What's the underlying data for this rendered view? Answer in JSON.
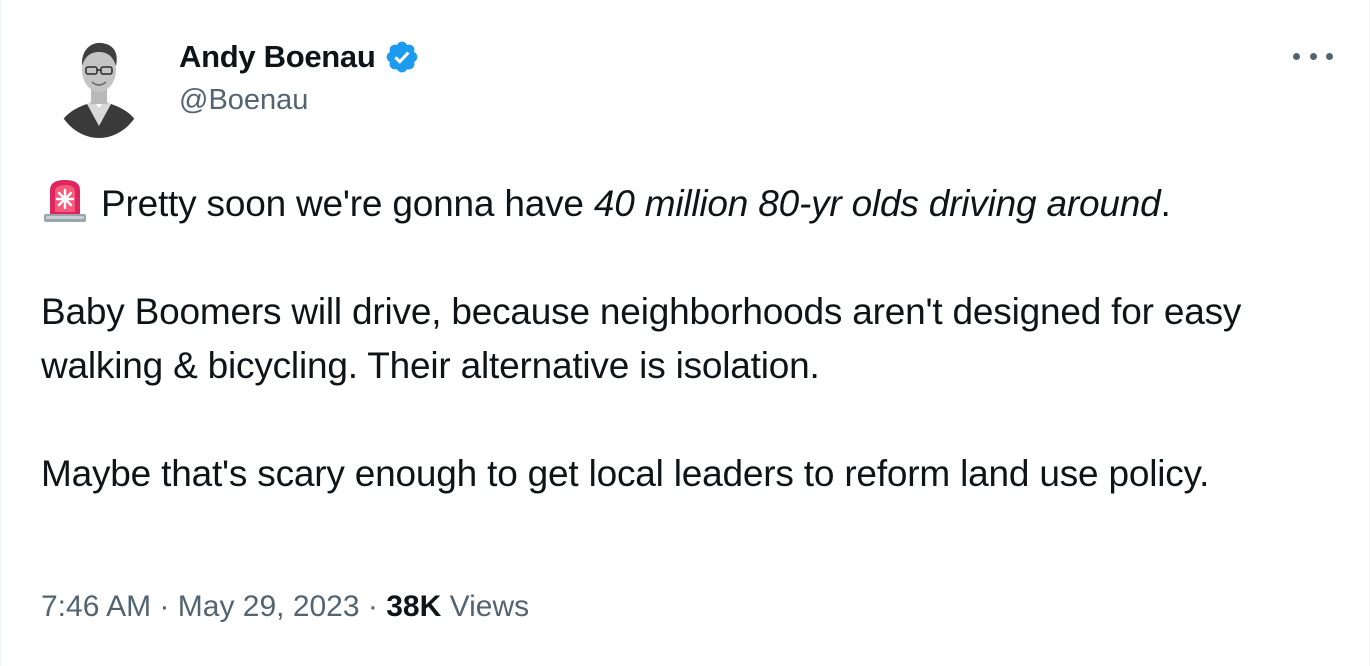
{
  "author": {
    "display_name": "Andy Boenau",
    "handle": "@Boenau",
    "verified_icon": "verified-badge-icon",
    "avatar": "author-avatar-photo"
  },
  "tweet": {
    "siren_icon": "police-car-light-icon",
    "line1_plain": "Pretty soon we're gonna have ",
    "line1_italic": "40 million 80-yr olds driving around",
    "line1_end": ".",
    "paragraph2": "Baby Boomers will drive, because neighborhoods aren't designed for easy walking & bicycling. Their alternative is isolation.",
    "paragraph3": "Maybe that's scary enough to get local leaders to reform land use policy."
  },
  "meta": {
    "time": "7:46 AM",
    "separator": "·",
    "date": "May 29, 2023",
    "views_count": "38K",
    "views_label": "Views"
  },
  "colors": {
    "text": "#0f1419",
    "secondary": "#536471",
    "verified": "#1d9bf0",
    "siren": "#e0245e"
  },
  "menu": {
    "more_icon": "more-options-icon"
  }
}
